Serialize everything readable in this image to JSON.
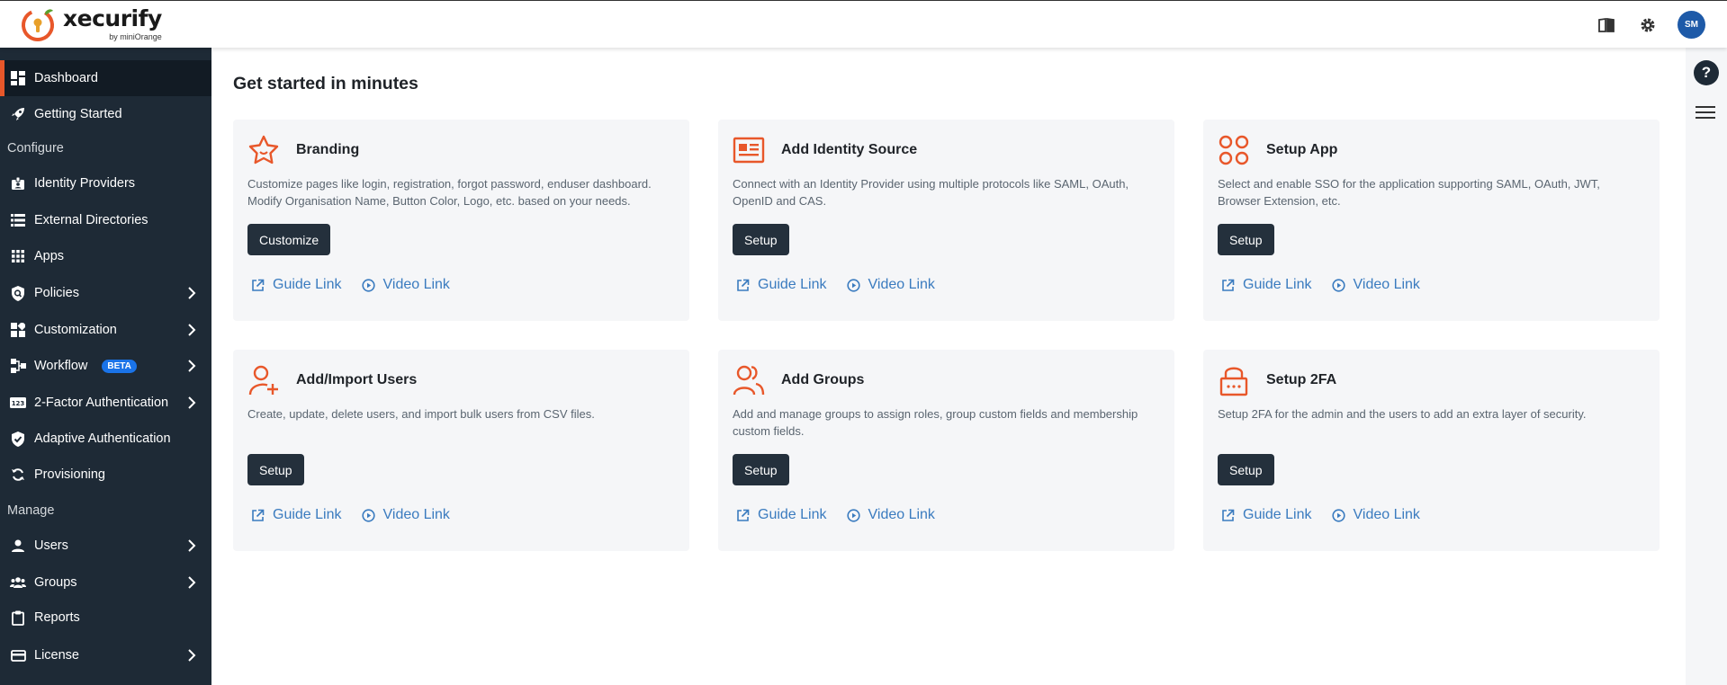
{
  "brand": {
    "name": "xecurify",
    "sub": "by miniOrange",
    "accent": "#e8572a"
  },
  "topbar": {
    "avatar_initials": "SM",
    "icons": [
      "book-icon",
      "gear-icon"
    ]
  },
  "sidebar": {
    "items": [
      {
        "label": "Dashboard",
        "icon": "dashboard-icon",
        "active": true
      },
      {
        "label": "Getting Started",
        "icon": "rocket-icon"
      },
      {
        "section": "Configure"
      },
      {
        "label": "Identity Providers",
        "icon": "id-badge-icon"
      },
      {
        "label": "External Directories",
        "icon": "list-icon"
      },
      {
        "label": "Apps",
        "icon": "apps-grid-icon"
      },
      {
        "label": "Policies",
        "icon": "policy-shield-icon",
        "chevron": true
      },
      {
        "label": "Customization",
        "icon": "customization-icon",
        "chevron": true
      },
      {
        "label": "Workflow",
        "icon": "workflow-icon",
        "badge": "BETA",
        "chevron": true
      },
      {
        "label": "2-Factor Authentication",
        "icon": "2fa-icon",
        "chevron": true
      },
      {
        "label": "Adaptive Authentication",
        "icon": "shield-check-icon"
      },
      {
        "label": "Provisioning",
        "icon": "sync-icon"
      },
      {
        "section": "Manage"
      },
      {
        "label": "Users",
        "icon": "user-icon",
        "chevron": true
      },
      {
        "label": "Groups",
        "icon": "groups-icon",
        "chevron": true
      },
      {
        "label": "Reports",
        "icon": "clipboard-icon"
      },
      {
        "label": "License",
        "icon": "credit-card-icon",
        "chevron": true
      }
    ]
  },
  "main": {
    "title": "Get started in minutes",
    "guide_label": "Guide Link",
    "video_label": "Video Link",
    "cards": [
      {
        "title": "Branding",
        "icon": "star-icon",
        "desc": "Customize pages like login, registration, forgot password, enduser dashboard. Modify Organisation Name, Button Color, Logo, etc. based on your needs.",
        "button": "Customize"
      },
      {
        "title": "Add Identity Source",
        "icon": "id-card-icon",
        "desc": "Connect with an Identity Provider using multiple protocols like SAML, OAuth, OpenID and CAS.",
        "button": "Setup"
      },
      {
        "title": "Setup App",
        "icon": "app-setup-icon",
        "desc": "Select and enable SSO for the application supporting SAML, OAuth, JWT, Browser Extension, etc.",
        "button": "Setup"
      },
      {
        "title": "Add/Import Users",
        "icon": "add-user-icon",
        "desc": "Create, update, delete users, and import bulk users from CSV files.",
        "button": "Setup"
      },
      {
        "title": "Add Groups",
        "icon": "users-group-icon",
        "desc": "Add and manage groups to assign roles, group custom fields and membership custom fields.",
        "button": "Setup"
      },
      {
        "title": "Setup 2FA",
        "icon": "lock-icon",
        "desc": "Setup 2FA for the admin and the users to add an extra layer of security.",
        "button": "Setup"
      }
    ]
  },
  "help_label": "?"
}
